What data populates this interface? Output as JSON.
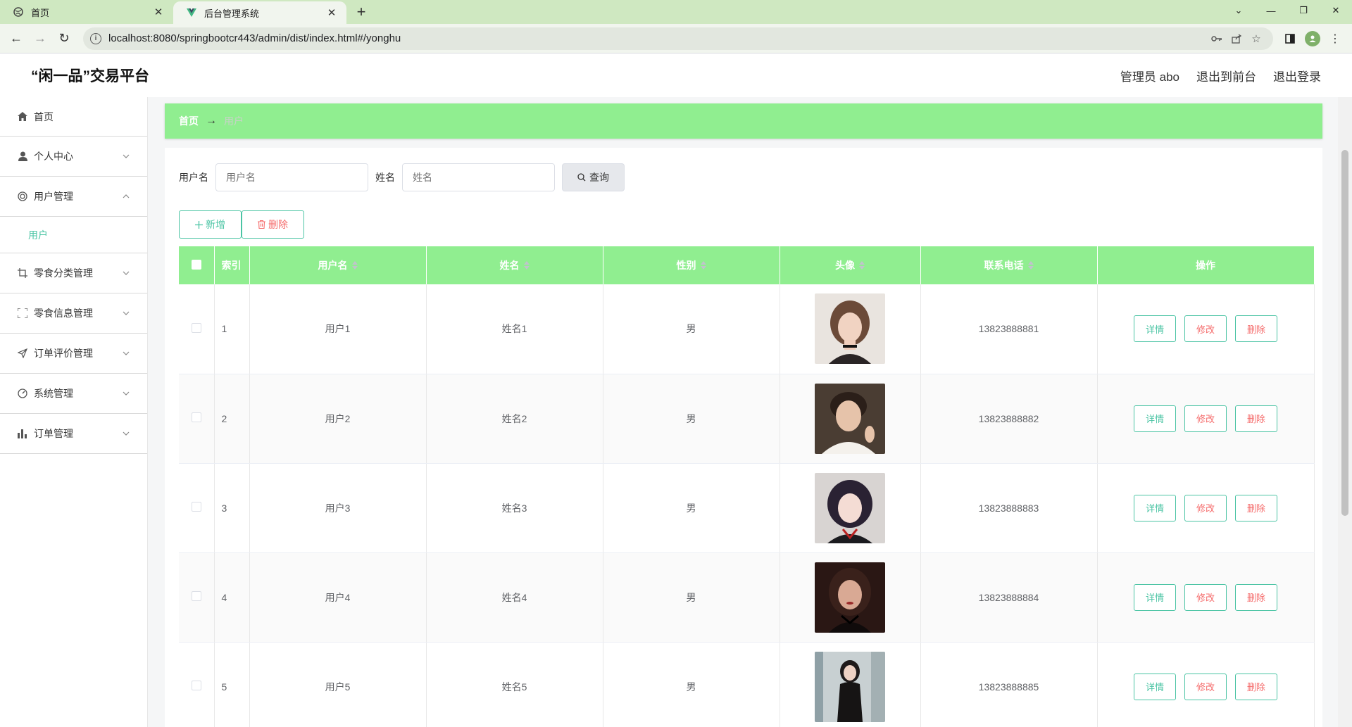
{
  "browser": {
    "tabs": [
      {
        "title": "首页",
        "favicon": "globe-icon",
        "active": false
      },
      {
        "title": "后台管理系统",
        "favicon": "vue-logo-icon",
        "active": true
      }
    ],
    "url": "localhost:8080/springbootcr443/admin/dist/index.html#/yonghu",
    "new_tab": "+"
  },
  "header": {
    "title": "“闲一品”交易平台",
    "admin": "管理员 abo",
    "to_front": "退出到前台",
    "logout": "退出登录"
  },
  "sidebar": {
    "items": [
      {
        "label": "首页",
        "icon": "home-icon"
      },
      {
        "label": "个人中心",
        "icon": "user-icon"
      },
      {
        "label": "用户管理",
        "icon": "users-circle-icon",
        "expanded": true
      },
      {
        "label": "零食分类管理",
        "icon": "crop-icon"
      },
      {
        "label": "零食信息管理",
        "icon": "fullscreen-icon"
      },
      {
        "label": "订单评价管理",
        "icon": "send-icon"
      },
      {
        "label": "系统管理",
        "icon": "gauge-icon"
      },
      {
        "label": "订单管理",
        "icon": "bar-chart-icon"
      }
    ],
    "submenu": {
      "label": "用户"
    }
  },
  "breadcrumb": {
    "home": "首页",
    "sep": "→",
    "current": "用户"
  },
  "search": {
    "username_label": "用户名",
    "username_placeholder": "用户名",
    "name_label": "姓名",
    "name_placeholder": "姓名",
    "button": "查询"
  },
  "actions": {
    "add": "新增",
    "delete": "删除"
  },
  "table": {
    "headers": [
      "索引",
      "用户名",
      "姓名",
      "性别",
      "头像",
      "联系电话",
      "操作"
    ],
    "ops": {
      "detail": "详情",
      "edit": "修改",
      "delete": "删除"
    },
    "rows": [
      {
        "index": "1",
        "username": "用户1",
        "name": "姓名1",
        "gender": "男",
        "phone": "13823888881"
      },
      {
        "index": "2",
        "username": "用户2",
        "name": "姓名2",
        "gender": "男",
        "phone": "13823888882"
      },
      {
        "index": "3",
        "username": "用户3",
        "name": "姓名3",
        "gender": "男",
        "phone": "13823888883"
      },
      {
        "index": "4",
        "username": "用户4",
        "name": "姓名4",
        "gender": "男",
        "phone": "13823888884"
      },
      {
        "index": "5",
        "username": "用户5",
        "name": "姓名5",
        "gender": "男",
        "phone": "13823888885"
      }
    ]
  },
  "colors": {
    "accent": "#90ee90",
    "teal": "#4bc4a4",
    "danger": "#f56c6c"
  }
}
